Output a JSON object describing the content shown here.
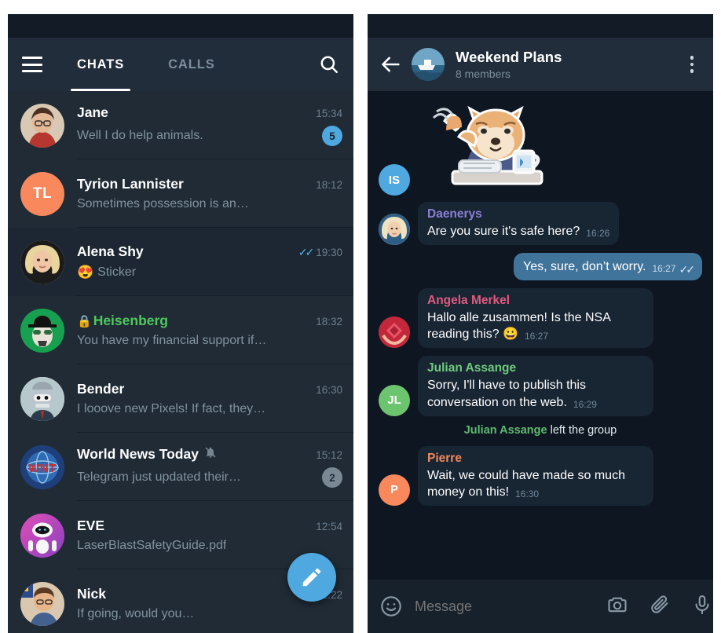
{
  "left_panel": {
    "appbar": {
      "menu_icon": "hamburger-menu-icon",
      "search_icon": "search-icon",
      "tabs": [
        {
          "label": "CHATS",
          "active": true
        },
        {
          "label": "CALLS",
          "active": false
        }
      ]
    },
    "chats": [
      {
        "name": "Jane",
        "preview": "Well I do help animals.",
        "time": "15:34",
        "badge": "5",
        "badge_muted": false,
        "avatar_type": "photo",
        "avatar_initials": "",
        "avatar_color": "#8c6a52",
        "secret": false,
        "muted": false,
        "checks": false,
        "emoji": "",
        "selected": false
      },
      {
        "name": "Tyrion Lannister",
        "preview": "Sometimes possession is an…",
        "time": "18:12",
        "badge": "",
        "badge_muted": false,
        "avatar_type": "initials",
        "avatar_initials": "TL",
        "avatar_color": "#f9885c",
        "secret": false,
        "muted": false,
        "checks": false,
        "emoji": "",
        "selected": false
      },
      {
        "name": "Alena Shy",
        "preview": "Sticker",
        "time": "19:30",
        "badge": "",
        "badge_muted": false,
        "avatar_type": "photo",
        "avatar_initials": "",
        "avatar_color": "#c6a98c",
        "secret": false,
        "muted": false,
        "checks": true,
        "emoji": "😍",
        "selected": true
      },
      {
        "name": "Heisenberg",
        "preview": "You have my financial support if…",
        "time": "18:32",
        "badge": "",
        "badge_muted": false,
        "avatar_type": "photo",
        "avatar_initials": "",
        "avatar_color": "#179e4e",
        "secret": true,
        "muted": false,
        "checks": false,
        "emoji": "",
        "selected": false
      },
      {
        "name": "Bender",
        "preview": "I looove new Pixels! If fact, they…",
        "time": "16:30",
        "badge": "",
        "badge_muted": false,
        "avatar_type": "photo",
        "avatar_initials": "",
        "avatar_color": "#9fb6c6",
        "secret": false,
        "muted": false,
        "checks": false,
        "emoji": "",
        "selected": false
      },
      {
        "name": "World News Today",
        "preview": "Telegram just updated their…",
        "time": "15:12",
        "badge": "2",
        "badge_muted": true,
        "avatar_type": "photo",
        "avatar_initials": "",
        "avatar_color": "#2b4f8e",
        "secret": false,
        "muted": true,
        "checks": false,
        "emoji": "",
        "selected": false
      },
      {
        "name": "EVE",
        "preview": "LaserBlastSafetyGuide.pdf",
        "time": "12:54",
        "badge": "",
        "badge_muted": false,
        "avatar_type": "photo",
        "avatar_initials": "",
        "avatar_color": "#c43fa8",
        "secret": false,
        "muted": false,
        "checks": false,
        "emoji": "",
        "selected": false
      },
      {
        "name": "Nick",
        "preview": "If going,­ would you…",
        "time": "12:22",
        "badge": "",
        "badge_muted": false,
        "avatar_type": "photo",
        "avatar_initials": "",
        "avatar_color": "#6a5a7a",
        "secret": false,
        "muted": false,
        "checks": false,
        "emoji": "",
        "selected": false
      }
    ],
    "fab": {
      "icon": "compose-pencil-icon",
      "color": "#4fa9e0"
    }
  },
  "right_panel": {
    "header": {
      "back_icon": "back-arrow-icon",
      "title": "Weekend Plans",
      "subtitle": "8 members",
      "menu_icon": "more-vertical-icon"
    },
    "messages": [
      {
        "kind": "sticker",
        "avatar_initials": "IS",
        "avatar_color": "#4fa9e0",
        "sticker": "shiba-dog-sticker"
      },
      {
        "kind": "in",
        "sender": "Daenerys",
        "sender_color": "#8c7fd6",
        "text": "Are you sure it's safe here?",
        "time": "16:26",
        "avatar_type": "photo",
        "avatar_initials": "",
        "avatar_color": "#d8c5a8"
      },
      {
        "kind": "out",
        "sender": "",
        "sender_color": "",
        "text": "Yes, sure, don’t worry.",
        "time": "16:27",
        "checks": true
      },
      {
        "kind": "in",
        "sender": "Angela Merkel",
        "sender_color": "#e05a7f",
        "text": "Hallo alle zusammen! Is the NSA reading this? 😀",
        "time": "16:27",
        "avatar_type": "photo",
        "avatar_initials": "",
        "avatar_color": "#c2283a"
      },
      {
        "kind": "in",
        "sender": "Julian Assange",
        "sender_color": "#6fca7d",
        "text": "Sorry, I'll have to publish this conversation on the web.",
        "time": "16:29",
        "avatar_type": "initials",
        "avatar_initials": "JL",
        "avatar_color": "#6dc46f"
      },
      {
        "kind": "service",
        "actor": "Julian Assange",
        "text": " left the group"
      },
      {
        "kind": "in",
        "sender": "Pierre",
        "sender_color": "#f0885b",
        "text": "Wait, we could have made so much money on this!",
        "time": "16:30",
        "avatar_type": "initials",
        "avatar_initials": "P",
        "avatar_color": "#f9885c"
      }
    ],
    "compose": {
      "emoji_icon": "smiley-face-icon",
      "placeholder": "Message",
      "camera_icon": "camera-icon",
      "attach_icon": "paperclip-icon",
      "mic_icon": "microphone-icon"
    }
  },
  "theme": {
    "accent": "#4fa9e0",
    "appbar_bg": "#212d3b",
    "list_bg": "#202b36",
    "list_selected_bg": "#1c2733",
    "conversation_bg": "#0e1621",
    "bubble_in": "#182533",
    "bubble_out": "#41749b",
    "secret_green": "#4dca5e"
  }
}
